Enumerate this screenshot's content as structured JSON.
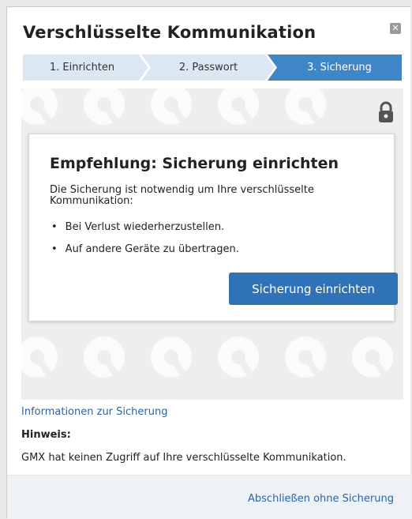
{
  "dialog": {
    "title": "Verschlüsselte Kommunikation",
    "close_icon": "close-icon",
    "close_glyph": "✕"
  },
  "steps": [
    {
      "label": "1. Einrichten",
      "active": false
    },
    {
      "label": "2. Passwort",
      "active": false
    },
    {
      "label": "3. Sicherung",
      "active": true
    }
  ],
  "colors": {
    "step_inactive": "#dbe7f2",
    "step_active": "#3f86c8",
    "primary_button": "#2f72b8",
    "link": "#2a63a8"
  },
  "hero": {
    "lock_icon": "padlock-icon",
    "background_pattern_icon": "key-icon"
  },
  "card": {
    "heading": "Empfehlung: Sicherung einrichten",
    "text": "Die Sicherung ist notwendig um Ihre verschlüsselte Kommunikation:",
    "bullets": [
      "Bei Verlust wiederherzustellen.",
      "Auf andere Geräte zu übertragen."
    ],
    "button_label": "Sicherung einrichten"
  },
  "info": {
    "link_label": "Informationen zur Sicherung",
    "note_label": "Hinweis:",
    "note_text": "GMX hat keinen Zugriff auf Ihre verschlüsselte Kommunikation."
  },
  "footer": {
    "finish_label": "Abschließen ohne Sicherung"
  }
}
